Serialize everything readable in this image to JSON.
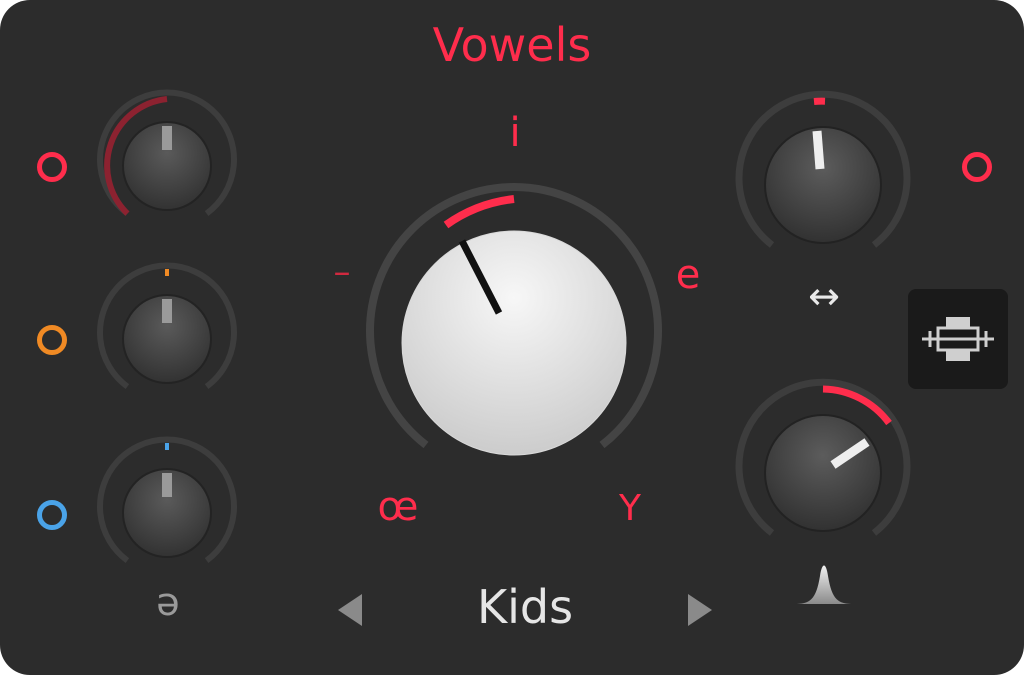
{
  "title": "Vowels",
  "vowels": {
    "top": "i",
    "left": "–",
    "right": "e",
    "bottom_left": "œ",
    "bottom_right": "Y"
  },
  "voice_label": "ə",
  "preset": {
    "name": "Kids",
    "prev_icon": "triangle-left-icon",
    "next_icon": "triangle-right-icon"
  },
  "swap_symbol": "↔",
  "colors": {
    "accent_red": "#ff2d4c",
    "accent_orange": "#f08a24",
    "accent_blue": "#4aa3e8",
    "panel_bg": "#2c2c2c",
    "side_button_bg": "#1a1a1a"
  },
  "knobs": {
    "left_top": {
      "color": "#ff2d4c",
      "value": 0.0
    },
    "left_middle": {
      "color": "#f08a24",
      "value": 0.5
    },
    "left_bottom": {
      "color": "#4aa3e8",
      "value": 0.5
    },
    "main": {
      "color": "#ff2d4c",
      "value": 0.4
    },
    "right_top": {
      "color": "#ff2d4c",
      "value": 0.52
    },
    "right_bottom": {
      "color": "#ff2d4c",
      "value": 0.68
    }
  },
  "icons": {
    "side_button": "link-chain-icon",
    "swap": "swap-horizontal-icon",
    "resonance": "peak-curve-icon"
  }
}
